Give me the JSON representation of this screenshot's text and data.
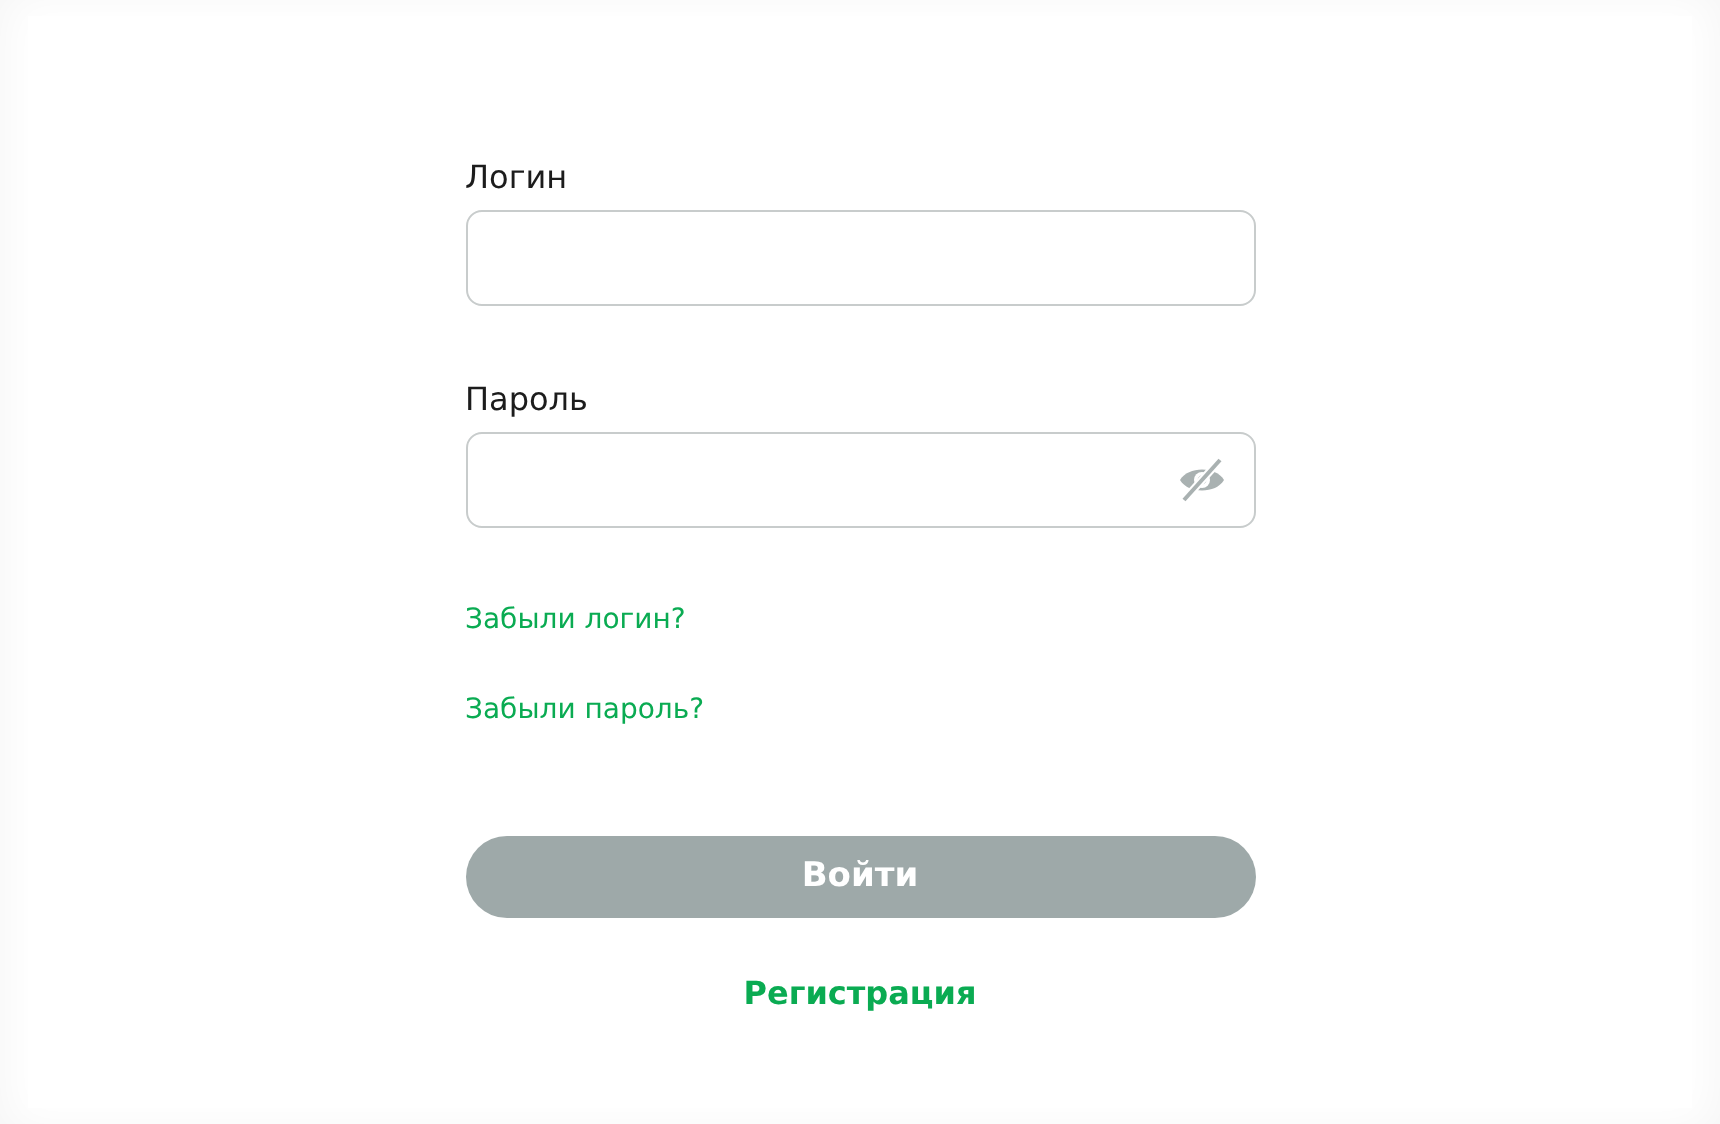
{
  "fields": [
    {
      "label": "Логин",
      "kind": "text"
    },
    {
      "label": "Пароль",
      "kind": "password",
      "visible": false
    }
  ],
  "links": [
    "Забыли логин?",
    "Забыли пароль?"
  ],
  "submit": {
    "label": "Войти",
    "disabled": true
  },
  "register": "Регистрация"
}
